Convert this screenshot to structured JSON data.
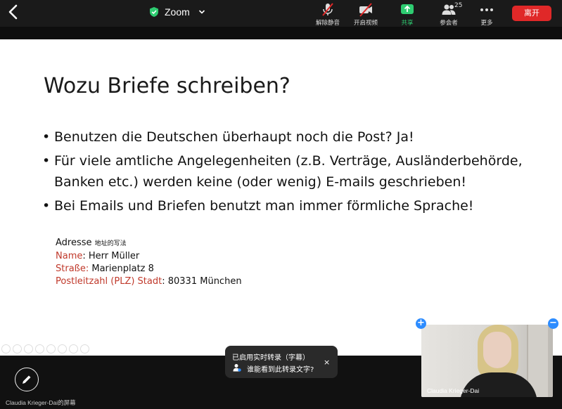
{
  "topbar": {
    "title": "Zoom",
    "buttons": {
      "unmute": "解除静音",
      "start_video": "开启视频",
      "share": "共享",
      "participants": "参会者",
      "participants_count": "25",
      "more": "更多"
    },
    "leave": "离开"
  },
  "slide": {
    "title": "Wozu Briefe schreiben?",
    "bullets": [
      "Benutzen die Deutschen überhaupt noch die Post? Ja!",
      "Für viele amtliche Angelegenheiten (z.B. Verträge, Ausländerbehörde, Banken etc.) werden keine (oder wenig) E-mails geschrieben!",
      "Bei Emails und Briefen benutzt man immer förmliche Sprache!"
    ],
    "address": {
      "heading": "Adresse",
      "heading_note": "地址的写法",
      "name_label": "Name",
      "name_value": ": Herr Müller",
      "street_label": "Straße:",
      "street_value": " Marienplatz 8",
      "postal_label": "Postleitzahl (PLZ) Stadt",
      "postal_value": ": 80331 München"
    }
  },
  "caption_popup": {
    "line1": "已启用实时转录（字幕）",
    "line2": "谁能看到此转录文字?",
    "close": "×"
  },
  "video": {
    "name": "Claudia Krieger-Dai",
    "plus": "+",
    "minus": "−"
  },
  "screen_label": "Claudia Krieger-Dai的屏幕",
  "colors": {
    "leave": "#e02828",
    "share_green": "#2ecc71",
    "accent_red_text": "#c0392b",
    "accent_blue": "#2d8cff",
    "unmute_strike": "#e02828"
  }
}
